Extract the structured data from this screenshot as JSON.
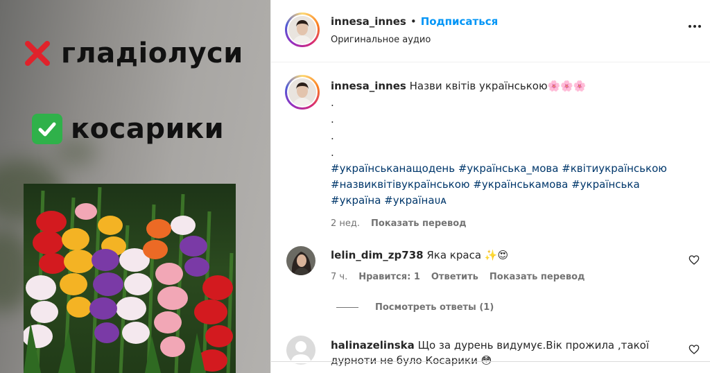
{
  "media": {
    "overlay_wrong": "гладіолуси",
    "overlay_right": "косарики",
    "wrong_icon": "cross-mark-icon",
    "right_icon": "check-mark-icon"
  },
  "post_header": {
    "username": "innesa_innes",
    "separator": "•",
    "follow_label": "Подписаться",
    "audio_label": "Оригинальное аудио",
    "more_icon": "more-options-icon"
  },
  "caption": {
    "username": "innesa_innes",
    "text": "Назви квітів українською",
    "emoji": "🌸🌸🌸",
    "dots": [
      ".",
      ".",
      ".",
      "."
    ],
    "hashtags_line1": "#українськанащодень #українська_мова #квітиукраїнською",
    "hashtags_line2": "#назвиквітівукраїнською #українськамова #українська",
    "hashtags_line3": "#україна #українаᴜᴀ",
    "time": "2 нед.",
    "translate_label": "Показать перевод"
  },
  "comments": [
    {
      "username": "lelin_dim_zp738",
      "text": "Яка краса",
      "emoji": "✨😍",
      "time": "7 ч.",
      "likes_label": "Нравится: 1",
      "reply_label": "Ответить",
      "translate_label": "Показать перевод"
    },
    {
      "username": "halinazelinska",
      "text_line1": "Що за дурень видумує.Вік прожила ,такої",
      "text_line2": "дурноти не було Косарики",
      "emoji": "😳"
    }
  ],
  "view_replies_label": "Посмотреть ответы (1)",
  "colors": {
    "link_blue": "#0095f6",
    "hashtag": "#00376b",
    "muted": "#737373",
    "text": "#262626"
  }
}
